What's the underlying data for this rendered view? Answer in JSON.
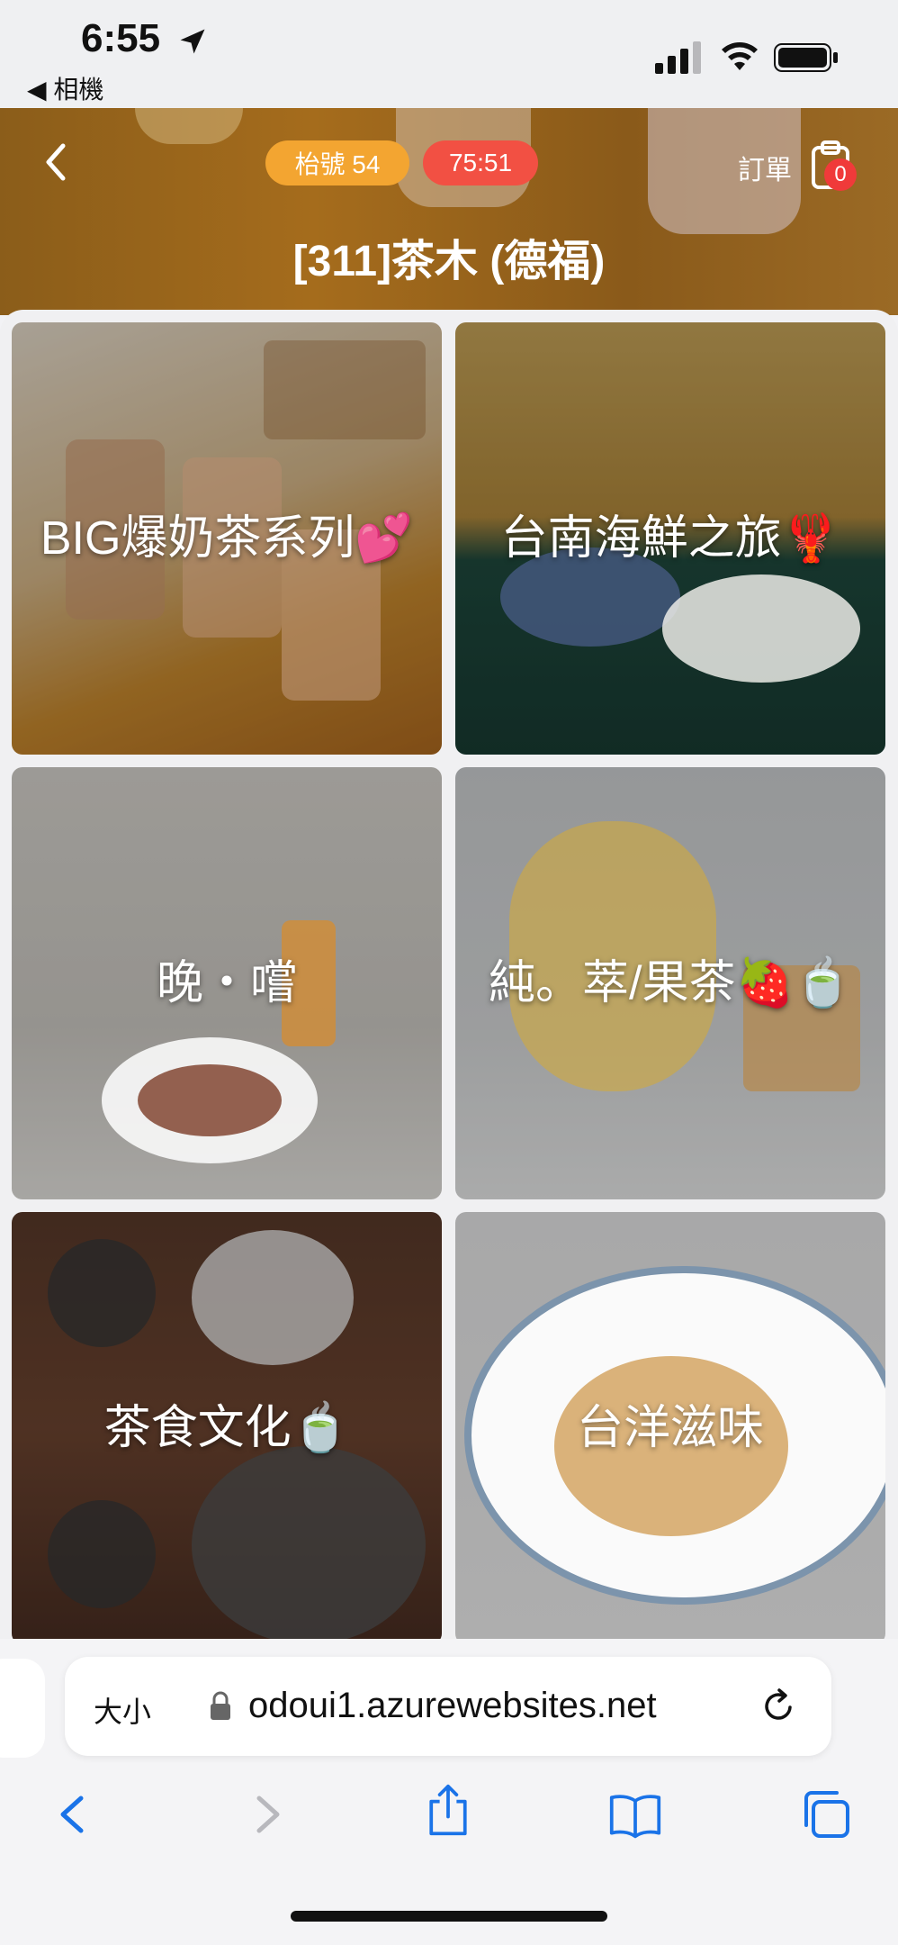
{
  "status_bar": {
    "time": "6:55",
    "back_app": "◀ 相機"
  },
  "header": {
    "table_number": "枱號 54",
    "timer": "75:51",
    "order_label": "訂單",
    "order_count": "0",
    "store_title": "[311]茶木 (德福)"
  },
  "categories": [
    {
      "label": "BIG爆奶茶系列💕"
    },
    {
      "label": "台南海鮮之旅🦞"
    },
    {
      "label": "晚・嚐"
    },
    {
      "label": "純。萃/果茶🍓🍵"
    },
    {
      "label": "茶食文化🍵"
    },
    {
      "label": "台洋滋味"
    }
  ],
  "browser": {
    "aa_label": "大小",
    "url": "odoui1.azurewebsites.net"
  },
  "colors": {
    "table_pill": "#f3a531",
    "timer_pill": "#f25043",
    "ios_blue": "#1a73e8"
  }
}
